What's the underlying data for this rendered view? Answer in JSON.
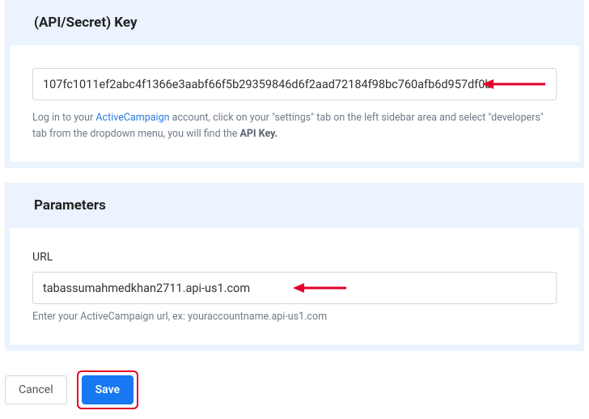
{
  "api_section": {
    "title": "(API/Secret) Key",
    "value": "107fc1011ef2abc4f1366e3aabf66f5b29359846d6f2aad72184f98bc760afb6d957df0b",
    "help_pre": "Log in to your ",
    "help_link": "ActiveCampaign",
    "help_mid": " account, click on your \"settings\" tab on the left sidebar area and select \"developers\" tab from the dropdown menu, you will find the ",
    "help_bold": "API Key.",
    "help_post": ""
  },
  "params_section": {
    "title": "Parameters",
    "url_label": "URL",
    "url_value": "tabassumahmedkhan2711.api-us1.com",
    "url_help": "Enter your ActiveCampaign url, ex: youraccountname.api-us1.com"
  },
  "footer": {
    "cancel": "Cancel",
    "save": "Save"
  },
  "colors": {
    "arrow": "#e4002b"
  }
}
